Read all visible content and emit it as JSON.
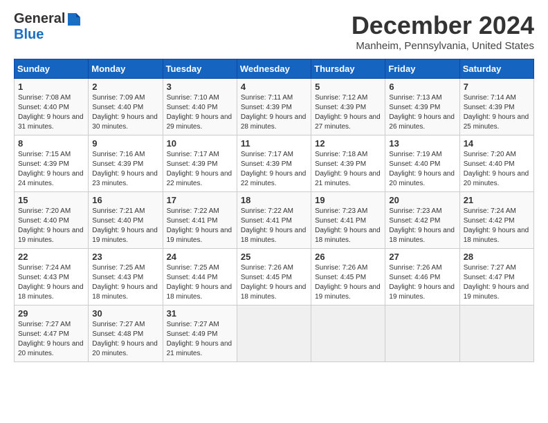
{
  "logo": {
    "line1": "General",
    "line2": "Blue"
  },
  "title": "December 2024",
  "location": "Manheim, Pennsylvania, United States",
  "days_of_week": [
    "Sunday",
    "Monday",
    "Tuesday",
    "Wednesday",
    "Thursday",
    "Friday",
    "Saturday"
  ],
  "weeks": [
    [
      {
        "day": "1",
        "sunrise": "7:08 AM",
        "sunset": "4:40 PM",
        "daylight": "9 hours and 31 minutes."
      },
      {
        "day": "2",
        "sunrise": "7:09 AM",
        "sunset": "4:40 PM",
        "daylight": "9 hours and 30 minutes."
      },
      {
        "day": "3",
        "sunrise": "7:10 AM",
        "sunset": "4:40 PM",
        "daylight": "9 hours and 29 minutes."
      },
      {
        "day": "4",
        "sunrise": "7:11 AM",
        "sunset": "4:39 PM",
        "daylight": "9 hours and 28 minutes."
      },
      {
        "day": "5",
        "sunrise": "7:12 AM",
        "sunset": "4:39 PM",
        "daylight": "9 hours and 27 minutes."
      },
      {
        "day": "6",
        "sunrise": "7:13 AM",
        "sunset": "4:39 PM",
        "daylight": "9 hours and 26 minutes."
      },
      {
        "day": "7",
        "sunrise": "7:14 AM",
        "sunset": "4:39 PM",
        "daylight": "9 hours and 25 minutes."
      }
    ],
    [
      {
        "day": "8",
        "sunrise": "7:15 AM",
        "sunset": "4:39 PM",
        "daylight": "9 hours and 24 minutes."
      },
      {
        "day": "9",
        "sunrise": "7:16 AM",
        "sunset": "4:39 PM",
        "daylight": "9 hours and 23 minutes."
      },
      {
        "day": "10",
        "sunrise": "7:17 AM",
        "sunset": "4:39 PM",
        "daylight": "9 hours and 22 minutes."
      },
      {
        "day": "11",
        "sunrise": "7:17 AM",
        "sunset": "4:39 PM",
        "daylight": "9 hours and 22 minutes."
      },
      {
        "day": "12",
        "sunrise": "7:18 AM",
        "sunset": "4:39 PM",
        "daylight": "9 hours and 21 minutes."
      },
      {
        "day": "13",
        "sunrise": "7:19 AM",
        "sunset": "4:40 PM",
        "daylight": "9 hours and 20 minutes."
      },
      {
        "day": "14",
        "sunrise": "7:20 AM",
        "sunset": "4:40 PM",
        "daylight": "9 hours and 20 minutes."
      }
    ],
    [
      {
        "day": "15",
        "sunrise": "7:20 AM",
        "sunset": "4:40 PM",
        "daylight": "9 hours and 19 minutes."
      },
      {
        "day": "16",
        "sunrise": "7:21 AM",
        "sunset": "4:40 PM",
        "daylight": "9 hours and 19 minutes."
      },
      {
        "day": "17",
        "sunrise": "7:22 AM",
        "sunset": "4:41 PM",
        "daylight": "9 hours and 19 minutes."
      },
      {
        "day": "18",
        "sunrise": "7:22 AM",
        "sunset": "4:41 PM",
        "daylight": "9 hours and 18 minutes."
      },
      {
        "day": "19",
        "sunrise": "7:23 AM",
        "sunset": "4:41 PM",
        "daylight": "9 hours and 18 minutes."
      },
      {
        "day": "20",
        "sunrise": "7:23 AM",
        "sunset": "4:42 PM",
        "daylight": "9 hours and 18 minutes."
      },
      {
        "day": "21",
        "sunrise": "7:24 AM",
        "sunset": "4:42 PM",
        "daylight": "9 hours and 18 minutes."
      }
    ],
    [
      {
        "day": "22",
        "sunrise": "7:24 AM",
        "sunset": "4:43 PM",
        "daylight": "9 hours and 18 minutes."
      },
      {
        "day": "23",
        "sunrise": "7:25 AM",
        "sunset": "4:43 PM",
        "daylight": "9 hours and 18 minutes."
      },
      {
        "day": "24",
        "sunrise": "7:25 AM",
        "sunset": "4:44 PM",
        "daylight": "9 hours and 18 minutes."
      },
      {
        "day": "25",
        "sunrise": "7:26 AM",
        "sunset": "4:45 PM",
        "daylight": "9 hours and 18 minutes."
      },
      {
        "day": "26",
        "sunrise": "7:26 AM",
        "sunset": "4:45 PM",
        "daylight": "9 hours and 19 minutes."
      },
      {
        "day": "27",
        "sunrise": "7:26 AM",
        "sunset": "4:46 PM",
        "daylight": "9 hours and 19 minutes."
      },
      {
        "day": "28",
        "sunrise": "7:27 AM",
        "sunset": "4:47 PM",
        "daylight": "9 hours and 19 minutes."
      }
    ],
    [
      {
        "day": "29",
        "sunrise": "7:27 AM",
        "sunset": "4:47 PM",
        "daylight": "9 hours and 20 minutes."
      },
      {
        "day": "30",
        "sunrise": "7:27 AM",
        "sunset": "4:48 PM",
        "daylight": "9 hours and 20 minutes."
      },
      {
        "day": "31",
        "sunrise": "7:27 AM",
        "sunset": "4:49 PM",
        "daylight": "9 hours and 21 minutes."
      },
      null,
      null,
      null,
      null
    ]
  ]
}
